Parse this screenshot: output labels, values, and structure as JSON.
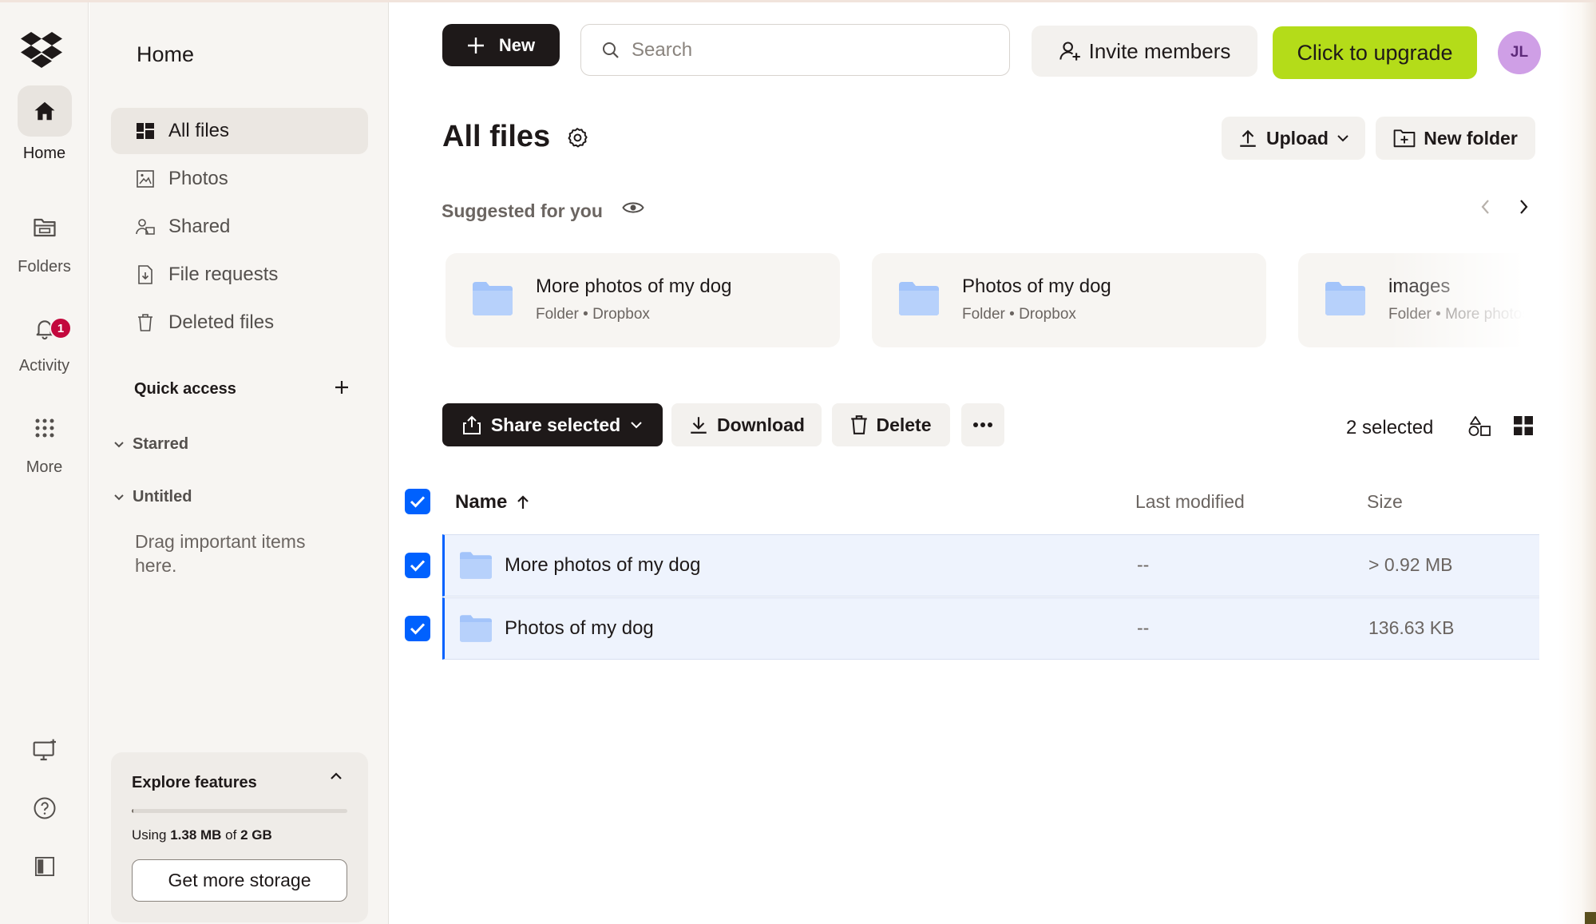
{
  "rail": {
    "items": [
      {
        "label": "Home",
        "icon": "home-icon"
      },
      {
        "label": "Folders",
        "icon": "folder-icon"
      },
      {
        "label": "Activity",
        "icon": "bell-icon",
        "badge": "1"
      },
      {
        "label": "More",
        "icon": "grid-icon"
      }
    ],
    "bottom_icons": [
      "desktop-app-icon",
      "help-icon",
      "sidebar-toggle-icon"
    ]
  },
  "nav": {
    "title": "Home",
    "items": [
      {
        "label": "All files",
        "icon": "all-files-icon",
        "active": true
      },
      {
        "label": "Photos",
        "icon": "photos-icon"
      },
      {
        "label": "Shared",
        "icon": "shared-icon"
      },
      {
        "label": "File requests",
        "icon": "file-requests-icon"
      },
      {
        "label": "Deleted files",
        "icon": "trash-icon"
      }
    ],
    "quick_access": "Quick access",
    "sections": [
      "Starred",
      "Untitled"
    ],
    "drag_hint": "Drag important items here."
  },
  "explore": {
    "title": "Explore features",
    "usage_prefix": "Using ",
    "usage_used": "1.38 MB",
    "usage_mid": " of ",
    "usage_total": "2 GB",
    "usage_fraction": 0.0007,
    "button": "Get more storage"
  },
  "topbar": {
    "new_label": "New",
    "search_placeholder": "Search",
    "invite_label": "Invite members",
    "upgrade_label": "Click to upgrade",
    "avatar_initials": "JL"
  },
  "main": {
    "title": "All files",
    "upload_label": "Upload",
    "new_folder_label": "New folder",
    "suggested_title": "Suggested for you",
    "suggestions": [
      {
        "name": "More photos of my dog",
        "meta": "Folder • Dropbox"
      },
      {
        "name": "Photos of my dog",
        "meta": "Folder • Dropbox"
      },
      {
        "name": "images",
        "meta": "Folder • More photos"
      }
    ],
    "actions": {
      "share": "Share selected",
      "download": "Download",
      "delete": "Delete"
    },
    "selected_count": "2 selected",
    "columns": {
      "name": "Name",
      "modified": "Last modified",
      "size": "Size"
    },
    "rows": [
      {
        "name": "More photos of my dog",
        "modified": "--",
        "size": "> 0.92 MB",
        "selected": true
      },
      {
        "name": "Photos of my dog",
        "modified": "--",
        "size": "136.63 KB",
        "selected": true
      }
    ]
  },
  "colors": {
    "accent_blue": "#0061fe",
    "upgrade_green": "#b4dc19",
    "badge_red": "#c3083d",
    "folder_blue": "#a3c4fa",
    "avatar_purple": "#cf9fe6"
  }
}
